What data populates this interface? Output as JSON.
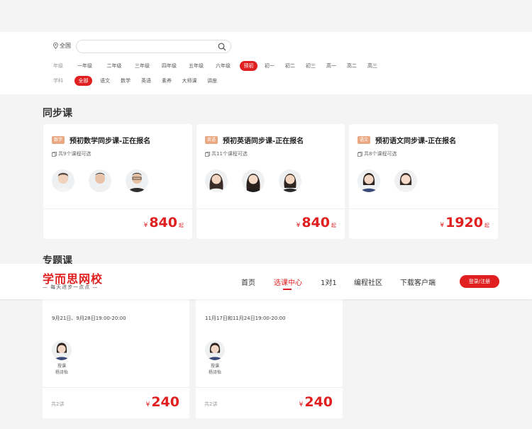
{
  "filters": {
    "location": "全国",
    "search_placeholder": "",
    "grade_label": "年级",
    "grades": [
      "一年级",
      "二年级",
      "三年级",
      "四年级",
      "五年级",
      "六年级",
      "预初",
      "初一",
      "初二",
      "初三",
      "高一",
      "高二",
      "高三"
    ],
    "grade_active": "预初",
    "subject_label": "学科",
    "subjects": [
      "全部",
      "语文",
      "数学",
      "英语",
      "素养",
      "大师课",
      "讲座"
    ],
    "subject_active": "全部"
  },
  "sync": {
    "title": "同步课",
    "cards": [
      {
        "badge": "数学",
        "title": "预初数学同步课-正在报名",
        "count": "共9个课程可选",
        "currency": "¥",
        "price": "840",
        "suffix": "起",
        "teachers": 3
      },
      {
        "badge": "英语",
        "title": "预初英语同步课-正在报名",
        "count": "共11个课程可选",
        "currency": "¥",
        "price": "840",
        "suffix": "起",
        "teachers": 3
      },
      {
        "badge": "语文",
        "title": "预初语文同步课-正在报名",
        "count": "共8个课程可选",
        "currency": "¥",
        "price": "1920",
        "suffix": "起",
        "teachers": 2
      }
    ]
  },
  "special": {
    "title": "专题课",
    "cards": [
      {
        "date": "9月21日、9月28日19:00-20:00",
        "role": "授课",
        "teacher": "杨诗怡",
        "lessons": "共2讲",
        "currency": "¥",
        "price": "240"
      },
      {
        "date": "11月17日和11月24日19:00-20:00",
        "role": "授课",
        "teacher": "杨诗怡",
        "lessons": "共2讲",
        "currency": "¥",
        "price": "240"
      }
    ]
  },
  "nav": {
    "logo": "学而思网校",
    "slogan": "— 每天进步一点点 —",
    "items": [
      "首页",
      "选课中心",
      "1对1",
      "编程社区",
      "下载客户端"
    ],
    "active": "选课中心",
    "login": "登录/注册"
  },
  "colors": {
    "accent": "#e02020",
    "badge": "#e9a882",
    "page_bg": "#f4f4f4"
  }
}
